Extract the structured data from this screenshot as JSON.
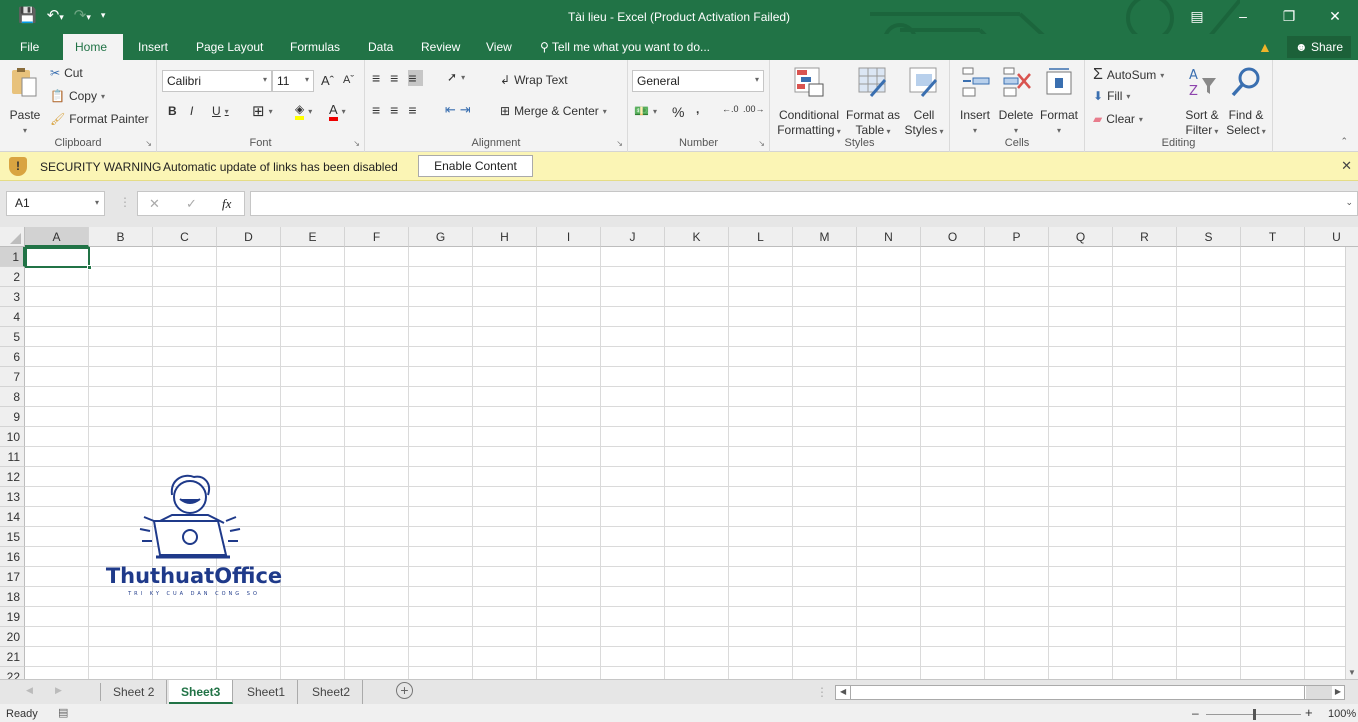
{
  "window": {
    "title": "Tài lieu - Excel (Product Activation Failed)",
    "controls": [
      "ribbon-display-options",
      "minimize",
      "restore",
      "close"
    ]
  },
  "qat": {
    "save": "save-icon",
    "undo": "undo-icon",
    "redo": "redo-icon",
    "customize": "customize-icon"
  },
  "tabs": [
    {
      "label": "File"
    },
    {
      "label": "Home",
      "active": true
    },
    {
      "label": "Insert"
    },
    {
      "label": "Page Layout"
    },
    {
      "label": "Formulas"
    },
    {
      "label": "Data"
    },
    {
      "label": "Review"
    },
    {
      "label": "View"
    }
  ],
  "tellme": "Tell me what you want to do...",
  "share_label": "Share",
  "ribbon": {
    "clipboard": {
      "label": "Clipboard",
      "paste": "Paste",
      "cut": "Cut",
      "copy": "Copy",
      "format_painter": "Format Painter"
    },
    "font": {
      "label": "Font",
      "font_name": "Calibri",
      "font_size": "11",
      "bold": "B",
      "italic": "I",
      "underline": "U",
      "highlight_color": "#ffff00",
      "font_color": "#ff0000"
    },
    "alignment": {
      "label": "Alignment",
      "wrap_text": "Wrap Text",
      "merge_center": "Merge & Center"
    },
    "number": {
      "label": "Number",
      "format": "General",
      "percent": "%",
      "comma": ","
    },
    "styles": {
      "label": "Styles",
      "conditional": [
        "Conditional",
        "Formatting"
      ],
      "format_table": [
        "Format as",
        "Table"
      ],
      "cell_styles": [
        "Cell",
        "Styles"
      ]
    },
    "cells": {
      "label": "Cells",
      "insert": "Insert",
      "delete": "Delete",
      "format": "Format"
    },
    "editing": {
      "label": "Editing",
      "autosum": "AutoSum",
      "fill": "Fill",
      "clear": "Clear",
      "sort": [
        "Sort &",
        "Filter"
      ],
      "find": [
        "Find &",
        "Select"
      ]
    }
  },
  "security": {
    "title": "SECURITY WARNING",
    "message": "Automatic update of links has been disabled",
    "button": "Enable Content"
  },
  "formula_bar": {
    "name_box": "A1",
    "fx": "fx",
    "value": ""
  },
  "grid": {
    "columns": [
      "A",
      "B",
      "C",
      "D",
      "E",
      "F",
      "G",
      "H",
      "I",
      "J",
      "K",
      "L",
      "M",
      "N",
      "O",
      "P",
      "Q",
      "R",
      "S",
      "T",
      "U"
    ],
    "rows": [
      "1",
      "2",
      "3",
      "4",
      "5",
      "6",
      "7",
      "8",
      "9",
      "10",
      "11",
      "12",
      "13",
      "14",
      "15",
      "16",
      "17",
      "18",
      "19",
      "20",
      "21",
      "22"
    ],
    "selected": "A1"
  },
  "logo": {
    "name": "ThuthuatOffice",
    "tagline": "TRI KY CUA DAN CONG SO"
  },
  "sheets": [
    {
      "label": "Sheet 2"
    },
    {
      "label": "Sheet3",
      "active": true
    },
    {
      "label": "Sheet1"
    },
    {
      "label": "Sheet2"
    }
  ],
  "status": {
    "ready": "Ready",
    "zoom": "100%",
    "zoom_percent": 100
  },
  "colors": {
    "brand": "#217346",
    "warning_bar": "#fbf5b5"
  }
}
